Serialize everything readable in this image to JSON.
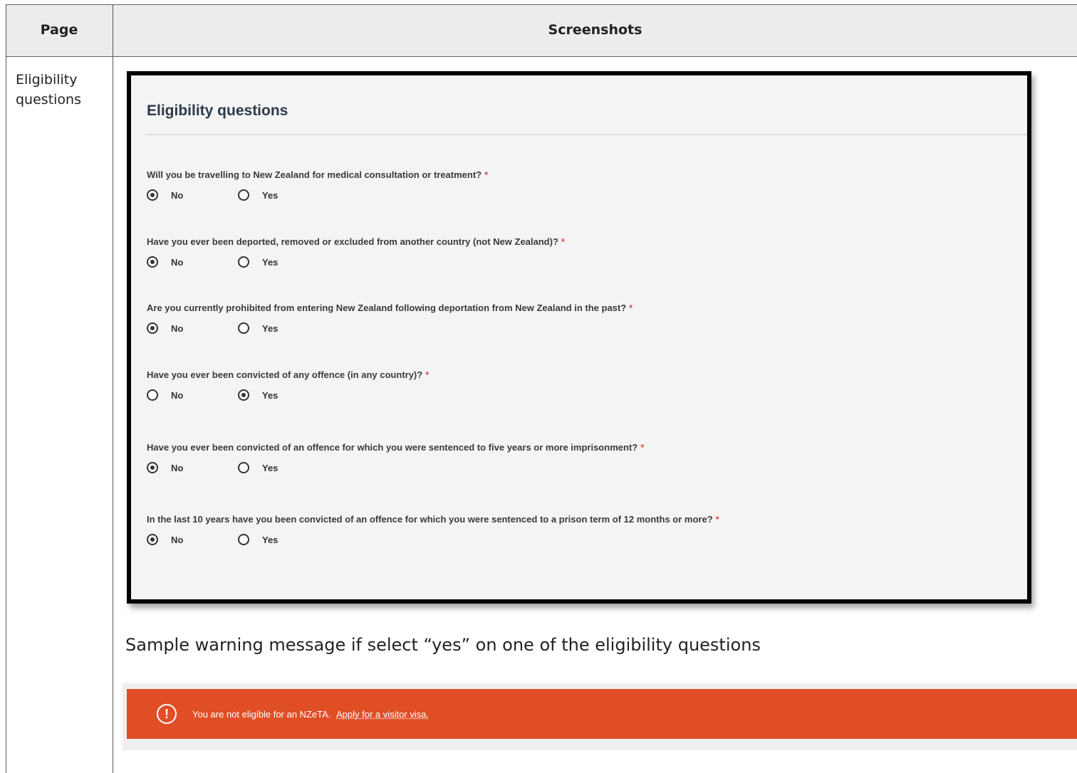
{
  "table": {
    "header_page": "Page",
    "header_screenshots": "Screenshots",
    "page_name": "Eligibility questions"
  },
  "form": {
    "title": "Eligibility questions",
    "required_mark": "*",
    "questions": [
      {
        "label": "Will you be travelling to New Zealand for medical consultation or treatment?",
        "no": "No",
        "yes": "Yes",
        "selected": "No"
      },
      {
        "label": "Have you ever been deported, removed or excluded from another country (not New Zealand)?",
        "no": "No",
        "yes": "Yes",
        "selected": "No"
      },
      {
        "label": "Are you currently prohibited from entering New Zealand following deportation from New Zealand in the past?",
        "no": "No",
        "yes": "Yes",
        "selected": "No"
      },
      {
        "label": "Have you ever been convicted of any offence (in any country)?",
        "no": "No",
        "yes": "Yes",
        "selected": "Yes"
      },
      {
        "label": "Have you ever been convicted of an offence for which you were sentenced to five years or more imprisonment?",
        "no": "No",
        "yes": "Yes",
        "selected": "No"
      },
      {
        "label": "In the last 10 years have you been convicted of an offence for which you were sentenced to a prison term of 12 months or more?",
        "no": "No",
        "yes": "Yes",
        "selected": "No"
      }
    ]
  },
  "caption": "Sample warning message if select “yes” on one of the eligibility questions",
  "warning": {
    "icon": "exclamation-circle-icon",
    "text": "You are not eligible for an NZeTA.",
    "link": "Apply for a visitor visa.",
    "color": "#e04e26"
  }
}
